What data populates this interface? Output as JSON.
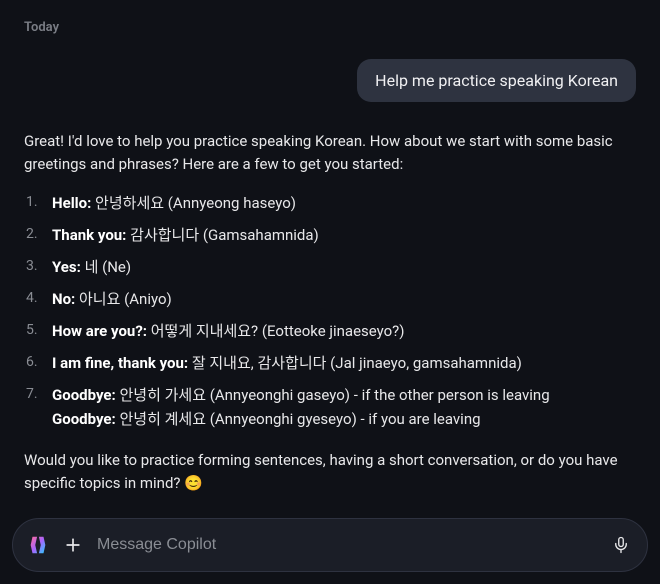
{
  "dateLabel": "Today",
  "userMessage": "Help me practice speaking Korean",
  "assistant": {
    "intro": "Great! I'd love to help you practice speaking Korean. How about we start with some basic greetings and phrases? Here are a few to get you started:",
    "phrases": [
      {
        "label": "Hello:",
        "body": " 안녕하세요 (Annyeong haseyo)"
      },
      {
        "label": "Thank you:",
        "body": " 감사합니다 (Gamsahamnida)"
      },
      {
        "label": "Yes:",
        "body": " 네 (Ne)"
      },
      {
        "label": "No:",
        "body": " 아니요 (Aniyo)"
      },
      {
        "label": "How are you?:",
        "body": " 어떻게 지내세요? (Eotteoke jinaeseyo?)"
      },
      {
        "label": "I am fine, thank you:",
        "body": " 잘 지내요, 감사합니다 (Jal jinaeyo, gamsahamnida)"
      },
      {
        "label": "Goodbye:",
        "body": " 안녕히 가세요 (Annyeonghi gaseyo) - if the other person is leaving",
        "sublabel": "Goodbye:",
        "subbody": " 안녕히 계세요 (Annyeonghi gyeseyo) - if you are leaving"
      }
    ],
    "outro": "Would you like to practice forming sentences, having a short conversation, or do you have specific topics in mind? 😊"
  },
  "input": {
    "placeholder": "Message Copilot"
  }
}
